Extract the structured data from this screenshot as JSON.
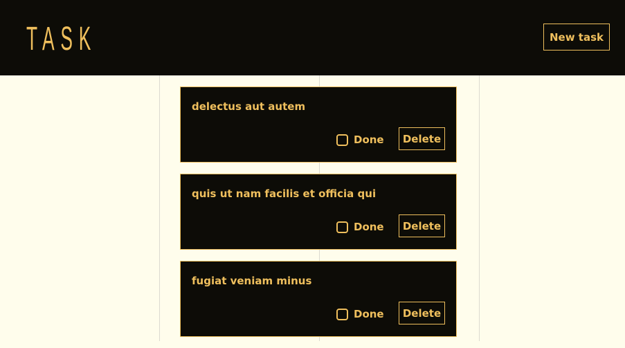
{
  "header": {
    "logo_text": "TASK",
    "new_task_label": "New task"
  },
  "colors": {
    "accent": "#efbf5d",
    "dark": "#0d0c07",
    "background": "#fffdec"
  },
  "tasks": [
    {
      "title": "delectus aut autem",
      "done_label": "Done",
      "delete_label": "Delete",
      "done": false
    },
    {
      "title": "quis ut nam facilis et officia qui",
      "done_label": "Done",
      "delete_label": "Delete",
      "done": false
    },
    {
      "title": "fugiat veniam minus",
      "done_label": "Done",
      "delete_label": "Delete",
      "done": false
    }
  ]
}
